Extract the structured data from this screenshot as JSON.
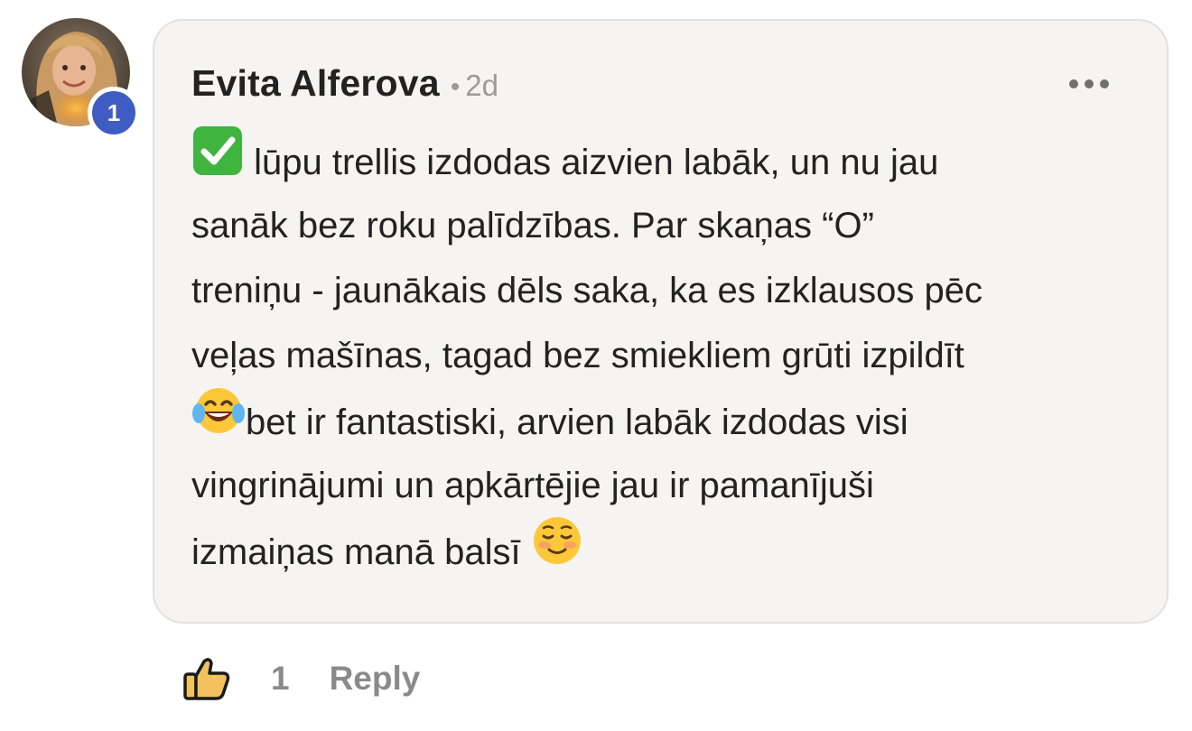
{
  "comment": {
    "author": "Evita Alferova",
    "separator": "•",
    "timestamp": "2d",
    "avatar_badge": "1",
    "body_lines": [
      [
        "check-emoji",
        " lūpu trellis izdodas aizvien labāk, un nu jau"
      ],
      [
        "",
        "sanāk bez roku palīdzības. Par skaņas “O”"
      ],
      [
        "",
        "treniņu - jaunākais dēls saka, ka es izklausos pēc"
      ],
      [
        "",
        "veļas mašīnas, tagad bez smiekliem grūti izpildīt"
      ],
      [
        "laugh-emoji",
        "bet ir fantastiski, arvien labāk izdodas visi"
      ],
      [
        "",
        "vingrinājumi un apkārtējie jau ir pamanījuši"
      ],
      [
        "",
        "izmaiņas manā balsī "
      ]
    ],
    "trailing_emoji": "smiling-blush-emoji",
    "more_icon": "more-horizontal-icon"
  },
  "actions": {
    "like_icon": "thumbs-up-icon",
    "like_count": "1",
    "reply_label": "Reply"
  },
  "colors": {
    "bubble_bg": "#f5f4f2",
    "bubble_border": "#e2e1df",
    "badge": "#3f5cc2",
    "muted_text": "#8a8a8a",
    "thumb_fill": "#f2c35c"
  }
}
